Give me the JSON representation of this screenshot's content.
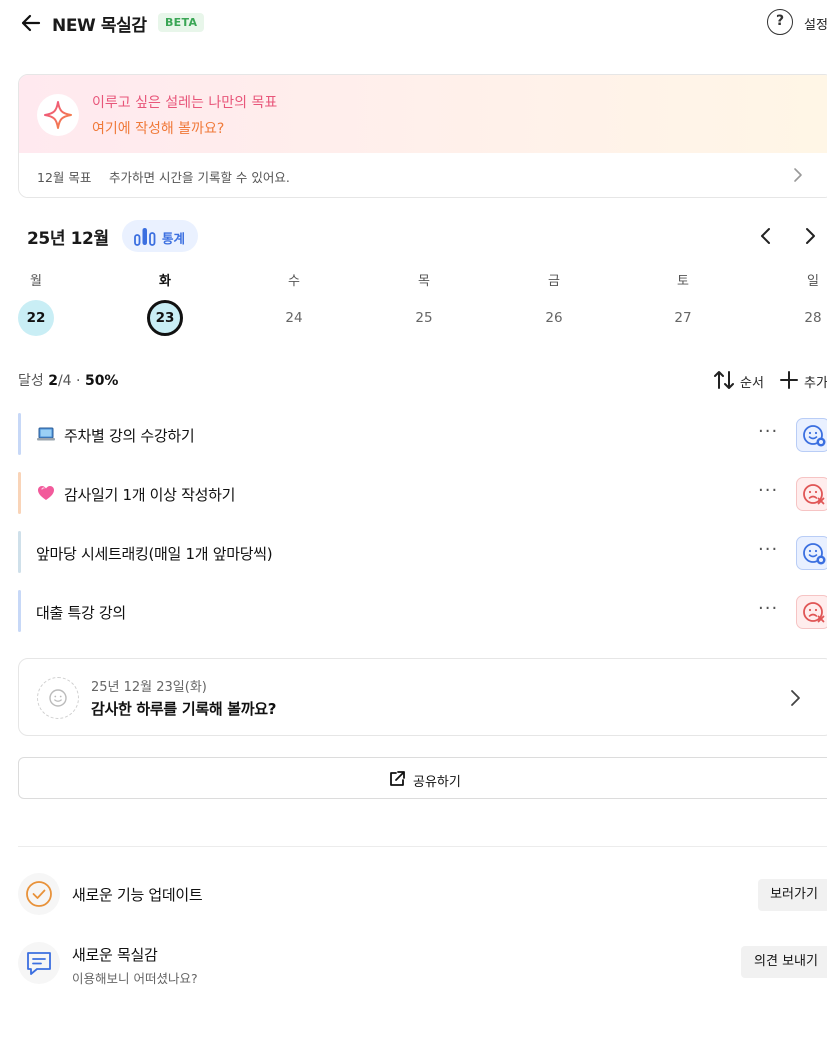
{
  "header": {
    "title": "NEW 목실감",
    "badge": "BETA",
    "help_glyph": "?",
    "settings_label": "설정"
  },
  "goal_banner": {
    "line1": "이루고 싶은 설레는 나만의 목표",
    "line2": "여기에 작성해 볼까요?",
    "month_goal": "12월 목표",
    "hint": "추가하면 시간을 기록할 수 있어요."
  },
  "calendar": {
    "month_label": "25년 12월",
    "stats_label": "통계",
    "weekdays": [
      "월",
      "화",
      "수",
      "목",
      "금",
      "토",
      "일"
    ],
    "dates": [
      "22",
      "23",
      "24",
      "25",
      "26",
      "27",
      "28"
    ],
    "selected_index": 1
  },
  "progress": {
    "label": "달성",
    "done": "2",
    "total": "/4",
    "separator": "·",
    "percent": "50%"
  },
  "toolbar": {
    "sort_label": "순서",
    "add_label": "추가"
  },
  "todos": [
    {
      "text": "주차별 강의 수강하기",
      "emoji": "laptop-icon",
      "status": "done"
    },
    {
      "text": "감사일기 1개 이상 작성하기",
      "emoji": "heart-icon",
      "status": "fail"
    },
    {
      "text": "앞마당 시세트래킹(매일 1개 앞마당씩)",
      "emoji": "",
      "status": "done"
    },
    {
      "text": "대출 특강 강의",
      "emoji": "",
      "status": "fail"
    }
  ],
  "diary": {
    "date": "25년 12월 23일(화)",
    "prompt": "감사한 하루를 기록해 볼까요?"
  },
  "share": {
    "label": "공유하기"
  },
  "footer": {
    "update_title": "새로운 기능 업데이트",
    "update_button": "보러가기",
    "feedback_title": "새로운 목실감",
    "feedback_sub": "이용해보니 어떠셨나요?",
    "feedback_button": "의견 보내기"
  },
  "colors": {
    "accent_blue": "#3b6fe0",
    "fail_red": "#e05555",
    "today_fill": "#c9eef5",
    "goal_pink": "#e8567a",
    "goal_orange": "#f07a3a"
  }
}
